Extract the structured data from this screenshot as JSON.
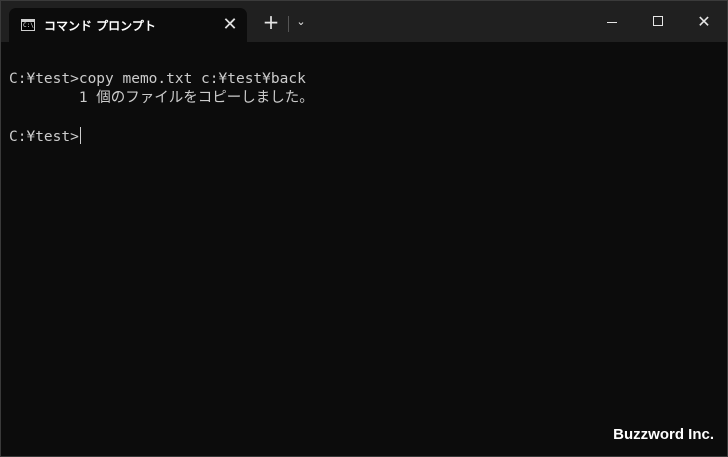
{
  "window": {
    "tab_title": "コマンド プロンプト",
    "tab_icon": "command-prompt-icon",
    "tab_icon_text": "C:\\",
    "close_tab_symbol": "✕",
    "new_tab_symbol": "+",
    "dropdown_symbol": "⌄",
    "close_symbol": "✕"
  },
  "console": {
    "lines": [
      "C:¥test>copy memo.txt c:¥test¥back",
      "        1 個のファイルをコピーしました。",
      "C:¥test>"
    ]
  },
  "watermark": "Buzzword Inc.",
  "colors": {
    "titlebar": "#202020",
    "console_bg": "#0c0c0c",
    "console_text": "#cccccc"
  }
}
